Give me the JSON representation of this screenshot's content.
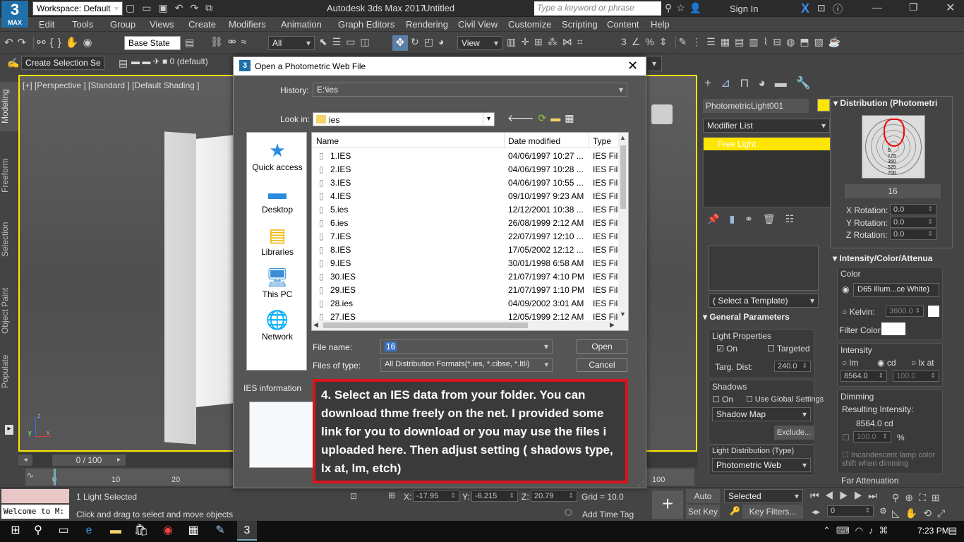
{
  "app": {
    "logo_number": "3",
    "logo_text": "MAX",
    "workspace": "Workspace: Default",
    "title": "Autodesk 3ds Max 2017",
    "file_name": "Untitled",
    "search_placeholder": "Type a keyword or phrase",
    "sign_in": "Sign In"
  },
  "menu": [
    "Edit",
    "Tools",
    "Group",
    "Views",
    "Create",
    "Modifiers",
    "Animation",
    "Graph Editors",
    "Rendering",
    "Civil View",
    "Customize",
    "Scripting",
    "Content",
    "Help"
  ],
  "toolbar": {
    "base_state": "Base State",
    "filter_all": "All",
    "view_ref": "View",
    "create_selection_set": "Create Selection Se",
    "layer": "0 (default)"
  },
  "viewport": {
    "label": "[+] [Perspective ] [Standard ] [Default Shading ]"
  },
  "left_tabs": [
    "Modeling",
    "Freeform",
    "Selection",
    "Object Paint",
    "Populate"
  ],
  "timeline": {
    "frame_counter": "0 / 100",
    "ticks": [
      "0",
      "10",
      "20",
      "100"
    ]
  },
  "status": {
    "selection": "1 Light Selected",
    "hint": "Click and drag to select and move objects",
    "welcome": "Welcome to M:",
    "x_label": "X:",
    "x_value": "-17.95",
    "y_label": "Y:",
    "y_value": "-6.215",
    "z_label": "Z:",
    "z_value": "20.79",
    "grid": "Grid = 10.0",
    "add_time_tag": "Add Time Tag",
    "auto_key": "Auto Key",
    "set_key": "Set Key",
    "key_mode": "Selected",
    "key_filters": "Key Filters...",
    "frame_field": "0"
  },
  "dialog": {
    "title": "Open a Photometric Web File",
    "history_label": "History:",
    "history_value": "E:\\ies",
    "lookin_label": "Look in:",
    "lookin_value": "ies",
    "nav": [
      "Quick access",
      "Desktop",
      "Libraries",
      "This PC",
      "Network"
    ],
    "columns": [
      "Name",
      "Date modified",
      "Type"
    ],
    "files": [
      {
        "name": "1.IES",
        "date": "04/06/1997 10:27 ...",
        "type": "IES File"
      },
      {
        "name": "2.IES",
        "date": "04/06/1997 10:28 ...",
        "type": "IES File"
      },
      {
        "name": "3.IES",
        "date": "04/06/1997 10:55 ...",
        "type": "IES File"
      },
      {
        "name": "4.IES",
        "date": "09/10/1997 9:23 AM",
        "type": "IES File"
      },
      {
        "name": "5.ies",
        "date": "12/12/2001 10:38 ...",
        "type": "IES File"
      },
      {
        "name": "6.ies",
        "date": "26/08/1999 2:12 AM",
        "type": "IES File"
      },
      {
        "name": "7.IES",
        "date": "22/07/1997 12:10 ...",
        "type": "IES File"
      },
      {
        "name": "8.IES",
        "date": "17/05/2002 12:12 ...",
        "type": "IES File"
      },
      {
        "name": "9.IES",
        "date": "30/01/1998 6:58 AM",
        "type": "IES File"
      },
      {
        "name": "30.IES",
        "date": "21/07/1997 4:10 PM",
        "type": "IES File"
      },
      {
        "name": "29.IES",
        "date": "21/07/1997 1:10 PM",
        "type": "IES File"
      },
      {
        "name": "28.ies",
        "date": "04/09/2002 3:01 AM",
        "type": "IES File"
      },
      {
        "name": "27.IES",
        "date": "12/05/1999 2:12 AM",
        "type": "IES File"
      }
    ],
    "filename_label": "File name:",
    "filename_value": "16",
    "filetype_label": "Files of type:",
    "filetype_value": "All Distribution Formats(*.ies, *.cibse, *.ltli)",
    "open": "Open",
    "cancel": "Cancel",
    "ies_info": "IES information",
    "annotation": "4. Select an IES data from your folder. You can download thme freely on the net. I provided some link for you to download or you may use the files i uploaded here. Then adjust setting ( shadows type, lx at, lm, etch)"
  },
  "panel": {
    "object_name": "PhotometricLight001",
    "modifier_list": "Modifier List",
    "stack_item": "Free Light",
    "template": "( Select a Template)",
    "general_params": "General Parameters",
    "light_props": "Light Properties",
    "on": "On",
    "targeted": "Targeted",
    "targ_dist_label": "Targ. Dist:",
    "targ_dist": "240.0",
    "shadows": "Shadows",
    "shadows_on": "On",
    "use_global": "Use Global Settings",
    "shadow_type": "Shadow Map",
    "exclude": "Exclude...",
    "light_dist_label": "Light Distribution (Type)",
    "light_dist": "Photometric Web",
    "distribution_title": "Distribution (Photometri",
    "web_file": "16",
    "polar_labels": [
      "0",
      "175",
      "350",
      "525",
      "700"
    ],
    "x_rot_label": "X Rotation:",
    "x_rot": "0.0",
    "y_rot_label": "Y Rotation:",
    "y_rot": "0.0",
    "z_rot_label": "Z Rotation:",
    "z_rot": "0.0",
    "intensity_title": "Intensity/Color/Attenua",
    "color_label": "Color",
    "color_preset": "D65 Illum...ce White)",
    "kelvin_label": "Kelvin:",
    "kelvin": "3600.0",
    "filter_color_label": "Filter Color:",
    "intensity_label": "Intensity",
    "lm": "lm",
    "cd": "cd",
    "lx_at": "lx at",
    "intensity_value": "8564.0",
    "lx_value": "100.0",
    "dimming_label": "Dimming",
    "resulting_label": "Resulting Intensity:",
    "resulting_value": "8564.0 cd",
    "dim_pct": "100.0",
    "pct": "%",
    "incandescent": "Incandescent lamp color shift when dimming",
    "far_atten": "Far Attenuation"
  },
  "taskbar": {
    "time": "7:23 PM"
  },
  "colors": {
    "accent_yellow": "#ffe600",
    "annotation_border": "#d9141b",
    "annotation_bg": "#3a3a3a"
  }
}
